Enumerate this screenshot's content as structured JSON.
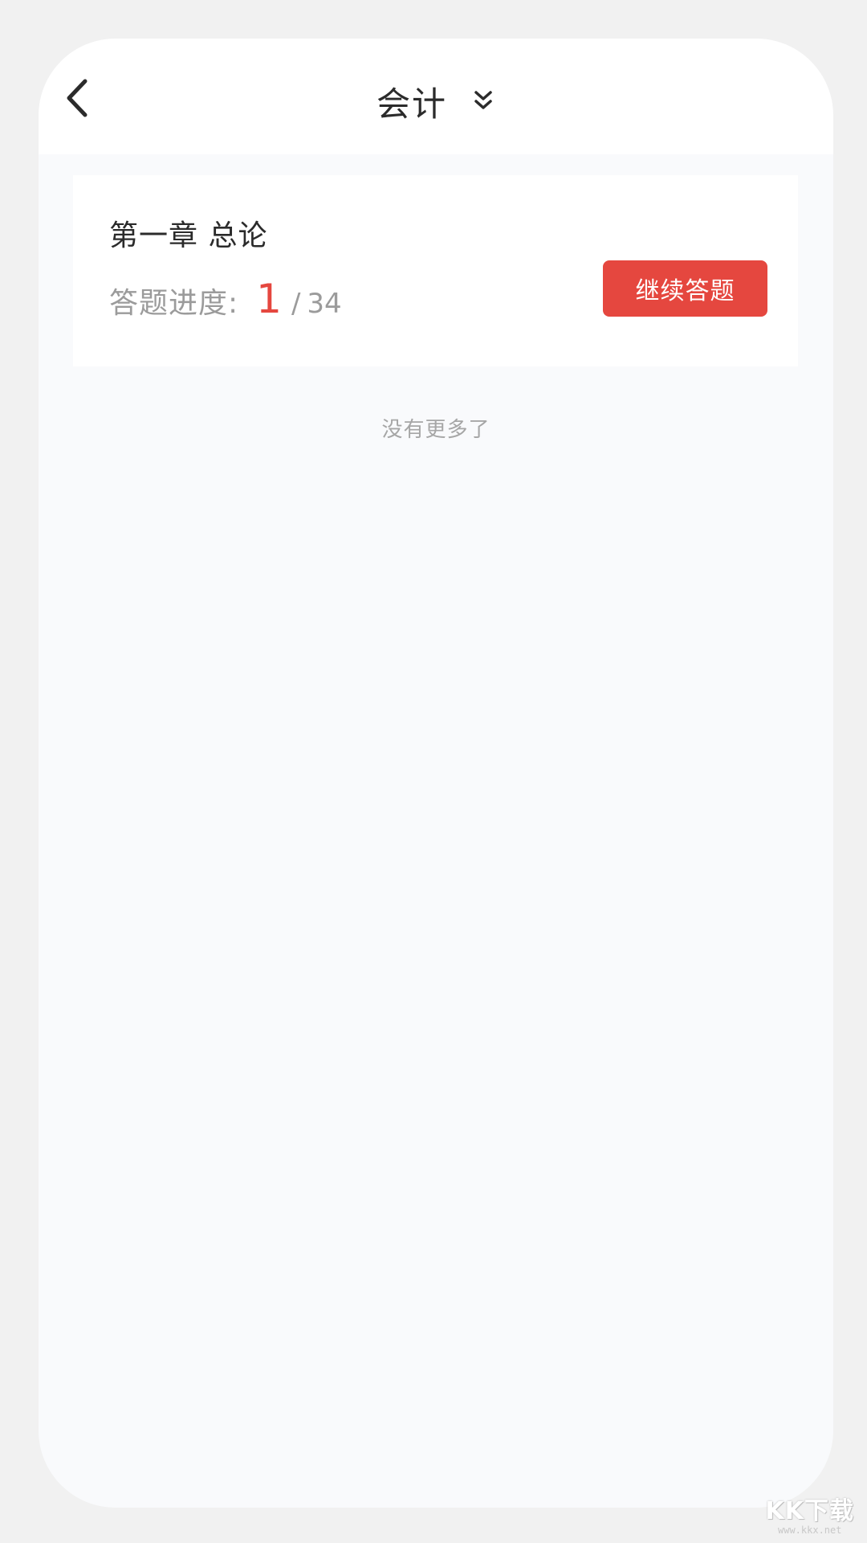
{
  "header": {
    "title": "会计"
  },
  "chapter": {
    "title": "第一章 总论",
    "progress_label": "答题进度:",
    "progress_current": "1",
    "progress_separator": "/",
    "progress_total": "34",
    "continue_label": "继续答题"
  },
  "list": {
    "end_text": "没有更多了"
  },
  "watermark": {
    "main": "KK下载",
    "sub": "www.kkx.net"
  },
  "colors": {
    "accent": "#e5473f",
    "background": "#f9fafc",
    "card": "#ffffff"
  },
  "icons": {
    "back": "chevron-left-icon",
    "dropdown": "double-chevron-down-icon"
  }
}
